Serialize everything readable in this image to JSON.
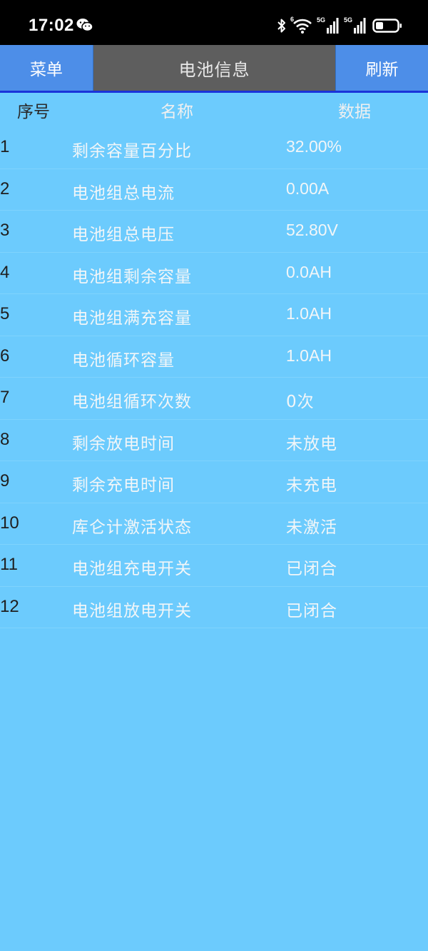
{
  "status_bar": {
    "time": "17:02",
    "icons": [
      "wechat-icon",
      "bluetooth-icon",
      "wifi-icon",
      "signal-5g-icon",
      "signal-5g-icon",
      "battery-icon"
    ],
    "wifi_label": "6",
    "sim1_label": "5G",
    "sim2_label": "5G"
  },
  "nav": {
    "menu_label": "菜单",
    "title": "电池信息",
    "refresh_label": "刷新"
  },
  "table": {
    "headers": {
      "index": "序号",
      "name": "名称",
      "value": "数据"
    },
    "rows": [
      {
        "index": "1",
        "name": "剩余容量百分比",
        "value": "32.00%"
      },
      {
        "index": "2",
        "name": "电池组总电流",
        "value": "0.00A"
      },
      {
        "index": "3",
        "name": "电池组总电压",
        "value": "52.80V"
      },
      {
        "index": "4",
        "name": "电池组剩余容量",
        "value": "0.0AH"
      },
      {
        "index": "5",
        "name": "电池组满充容量",
        "value": "1.0AH"
      },
      {
        "index": "6",
        "name": "电池循环容量",
        "value": "1.0AH"
      },
      {
        "index": "7",
        "name": "电池组循环次数",
        "value": "0次"
      },
      {
        "index": "8",
        "name": "剩余放电时间",
        "value": "未放电"
      },
      {
        "index": "9",
        "name": "剩余充电时间",
        "value": "未充电"
      },
      {
        "index": "10",
        "name": "库仑计激活状态",
        "value": "未激活"
      },
      {
        "index": "11",
        "name": "电池组充电开关",
        "value": "已闭合"
      },
      {
        "index": "12",
        "name": "电池组放电开关",
        "value": "已闭合"
      }
    ]
  },
  "colors": {
    "background": "#6ccbfd",
    "nav_button": "#4d8ee8",
    "nav_title_bg": "#5e5e5e",
    "nav_underline": "#1a33d9"
  }
}
